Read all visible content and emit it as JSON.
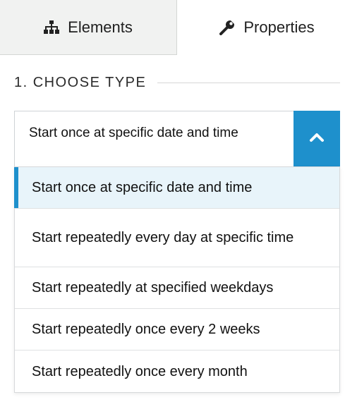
{
  "tabs": {
    "elements_label": "Elements",
    "properties_label": "Properties"
  },
  "section": {
    "heading": "1. CHOOSE TYPE"
  },
  "select": {
    "value": "Start once at specific date and time",
    "accent_color": "#1e90cc",
    "expanded": true,
    "options": [
      {
        "label": "Start once at specific date and time",
        "selected": true
      },
      {
        "label": "Start repeatedly every day at specific time",
        "selected": false
      },
      {
        "label": "Start repeatedly at specified weekdays",
        "selected": false
      },
      {
        "label": "Start repeatedly once every 2 weeks",
        "selected": false
      },
      {
        "label": "Start repeatedly once every month",
        "selected": false
      }
    ]
  },
  "icons": {
    "elements_tab": "sitemap-icon",
    "properties_tab": "wrench-icon",
    "toggle": "chevron-up-icon"
  }
}
